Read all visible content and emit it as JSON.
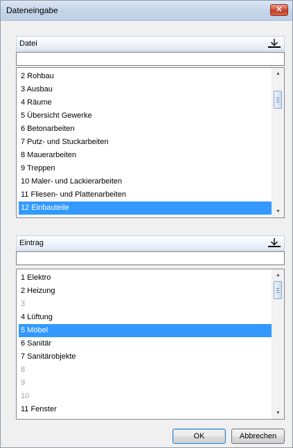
{
  "window": {
    "title": "Dateneingabe",
    "close_symbol": "✕"
  },
  "datei": {
    "header": "Datei",
    "search_value": "",
    "items": [
      {
        "label": "2 Rohbau",
        "state": "normal"
      },
      {
        "label": "3 Ausbau",
        "state": "normal"
      },
      {
        "label": "4 Räume",
        "state": "normal"
      },
      {
        "label": "5 Übersicht Gewerke",
        "state": "normal"
      },
      {
        "label": "6 Betonarbeiten",
        "state": "normal"
      },
      {
        "label": "7 Putz- und Stuckarbeiten",
        "state": "normal"
      },
      {
        "label": "8 Mauerarbeiten",
        "state": "normal"
      },
      {
        "label": "9 Treppen",
        "state": "normal"
      },
      {
        "label": "10 Maler- und Lackierarbeiten",
        "state": "normal"
      },
      {
        "label": "11 Fliesen- und Plattenarbeiten",
        "state": "normal"
      },
      {
        "label": "12 Einbauteile",
        "state": "selected"
      }
    ],
    "scroll_position": 0.1
  },
  "eintrag": {
    "header": "Eintrag",
    "search_value": "",
    "items": [
      {
        "label": "1 Elektro",
        "state": "normal"
      },
      {
        "label": "2 Heizung",
        "state": "normal"
      },
      {
        "label": "3",
        "state": "muted"
      },
      {
        "label": "4 Lüftung",
        "state": "normal"
      },
      {
        "label": "5 Möbel",
        "state": "selected"
      },
      {
        "label": "6 Sanitär",
        "state": "normal"
      },
      {
        "label": "7 Sanitärobjekte",
        "state": "normal"
      },
      {
        "label": "8",
        "state": "muted"
      },
      {
        "label": "9",
        "state": "muted"
      },
      {
        "label": "10",
        "state": "muted"
      },
      {
        "label": "11 Fenster",
        "state": "normal"
      }
    ],
    "scroll_position": 0.0
  },
  "buttons": {
    "ok": "OK",
    "cancel": "Abbrechen"
  },
  "icons": {
    "header_action": "download-to-tray-icon",
    "close": "close-icon"
  },
  "colors": {
    "selection": "#3399ff",
    "close_button": "#c94a32",
    "titlebar": "#c5d5e9"
  }
}
